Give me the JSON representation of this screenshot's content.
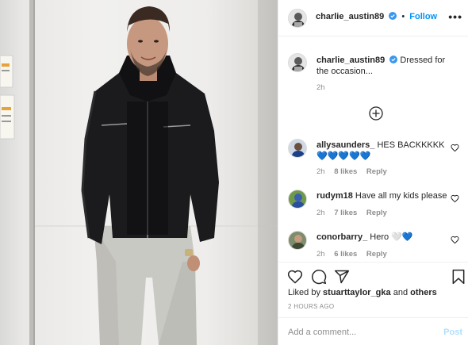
{
  "post": {
    "author": "charlie_austin89",
    "follow_label": "Follow",
    "separator": "•",
    "more_label": "•••",
    "caption": "Dressed for the occasion...",
    "caption_age": "2h"
  },
  "comments": [
    {
      "user": "allysaunders_",
      "text": "HES BACKKKKK 💙💙💙💙💙",
      "age": "2h",
      "likes": "8 likes",
      "reply": "Reply"
    },
    {
      "user": "rudym18",
      "text": "Have all my kids please",
      "age": "2h",
      "likes": "7 likes",
      "reply": "Reply"
    },
    {
      "user": "conorbarry_",
      "text": "Hero 🤍💙",
      "age": "2h",
      "likes": "6 likes",
      "reply": "Reply"
    }
  ],
  "likes_line": {
    "prefix": "Liked by",
    "user": "stuarttaylor_gka",
    "joiner": "and",
    "others": "others"
  },
  "posted_ago": "2 HOURS AGO",
  "comment_box": {
    "placeholder": "Add a comment...",
    "post_label": "Post"
  },
  "colors": {
    "link_blue": "#0095f6",
    "verified_blue": "#3897f0",
    "muted_grey": "#8e8e8e",
    "post_disabled": "#b2dffc"
  },
  "icons": [
    "load-more-comments-icon",
    "heart-icon",
    "comment-icon",
    "share-icon",
    "save-icon",
    "verified-badge-icon",
    "more-options-icon"
  ]
}
